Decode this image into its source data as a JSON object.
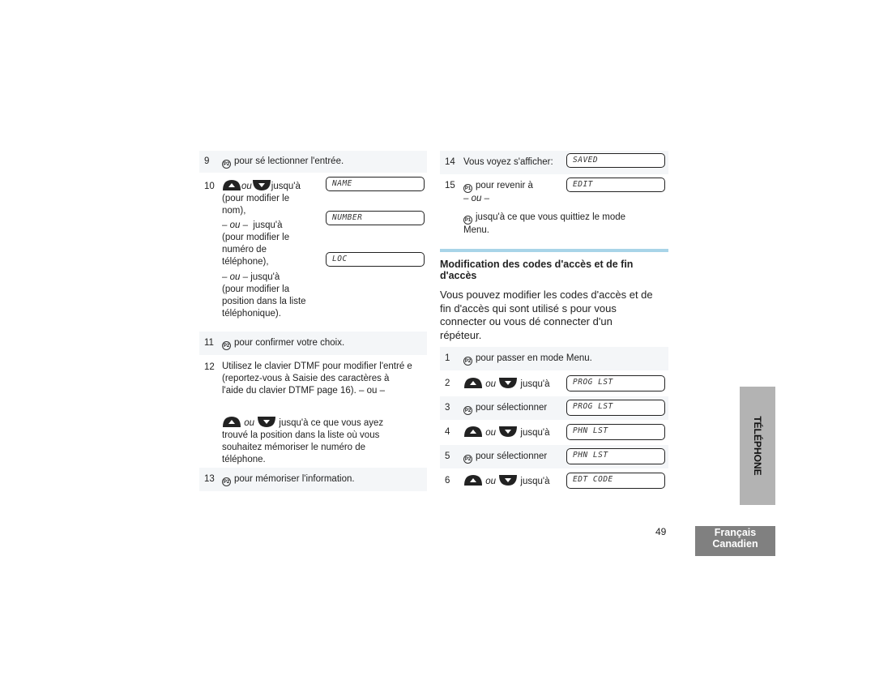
{
  "page_number": "49",
  "side_tab": "TÉLÉPHONE",
  "language_tab": {
    "line1": "Français",
    "line2": "Canadien"
  },
  "icons": {
    "p1": "P1",
    "p2": "P2"
  },
  "left_steps": {
    "s9": {
      "num": "9",
      "text": "pour sé lectionner l'entrée."
    },
    "s10": {
      "num": "10",
      "ou": "ou",
      "line1": "jusqu'à",
      "line2": "(pour modifier le",
      "line3": "nom),",
      "alt1_ou": "– ou –",
      "alt1_a": "jusqu'à",
      "alt1_b": "(pour modifier le",
      "alt1_c": "numéro de",
      "alt1_d": "téléphone),",
      "alt2_ou": "– ou –",
      "alt2_a": "jusqu'à",
      "alt2_b": "(pour modifier la",
      "alt2_c": "position dans la liste",
      "alt2_d": "téléphonique).",
      "displays": [
        "NAME",
        "NUMBER",
        "LOC"
      ]
    },
    "s11": {
      "num": "11",
      "text": "pour confirmer votre choix."
    },
    "s12": {
      "num": "12",
      "l1": "Utilisez le clavier DTMF pour modifier l'entré e",
      "l2": "(reportez-vous à Saisie des caractères à",
      "l3": "l'aide du clavier DTMF page 16). – ou –",
      "ou": "ou",
      "l4": "jusqu'à ce que vous ayez",
      "l5": "trouvé  la position dans la liste où vous",
      "l6": "souhaitez mémoriser le numéro de",
      "l7": "téléphone."
    },
    "s13": {
      "num": "13",
      "text": "pour mémoriser l'information."
    }
  },
  "right_steps": {
    "s14": {
      "num": "14",
      "text": "Vous voyez s'afficher:",
      "display": "SAVED"
    },
    "s15": {
      "num": "15",
      "text": "pour revenir à",
      "display": "EDIT",
      "ou": "– ou –",
      "alt1": "jusqu'à ce que vous quittiez le mode",
      "alt2": "Menu."
    }
  },
  "section": {
    "title_l1": "Modification des codes d'accès et de fin",
    "title_l2": "d'accès",
    "p1": "Vous pouvez modifier les codes d'accès et de",
    "p2": "fin d'accès qui sont utilisé s pour vous",
    "p3": "connecter ou vous dé connecter d'un",
    "p4": "répéteur.",
    "steps": [
      {
        "num": "1",
        "text": "pour passer en mode Menu."
      },
      {
        "num": "2",
        "ou": "ou",
        "text": "jusqu'à",
        "display": "PROG LST"
      },
      {
        "num": "3",
        "text": "pour sélectionner",
        "display": "PROG LST"
      },
      {
        "num": "4",
        "ou": "ou",
        "text": "jusqu'à",
        "display": "PHN LST"
      },
      {
        "num": "5",
        "text": "pour sélectionner",
        "display": "PHN LST"
      },
      {
        "num": "6",
        "ou": "ou",
        "text": "jusqu'à",
        "display": "EDT CODE"
      }
    ]
  }
}
